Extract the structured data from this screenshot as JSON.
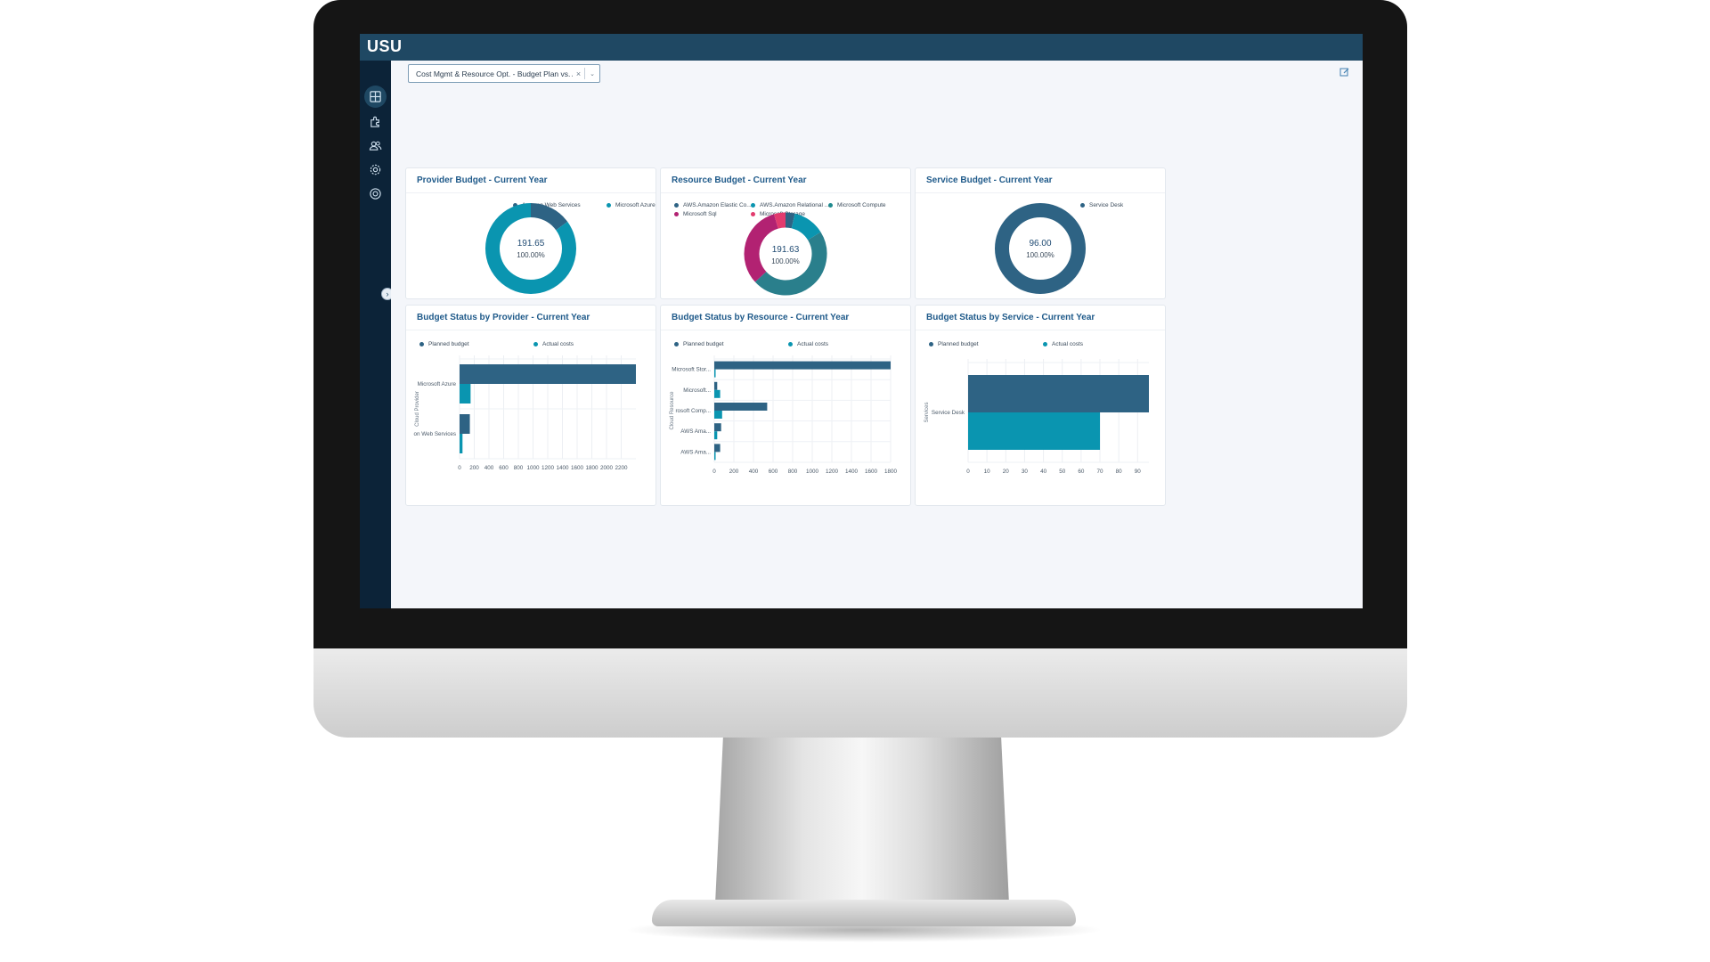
{
  "app": {
    "logo": "USU"
  },
  "toolbar": {
    "dashboard_value": "Cost Mgmt & Resource Opt. - Budget Plan vs. Act",
    "clear_label": "×",
    "chevron_label": "⌄"
  },
  "sidebar": {
    "items": [
      {
        "icon": "dashboard-icon",
        "active": true
      },
      {
        "icon": "puzzle-icon",
        "active": false
      },
      {
        "icon": "users-icon",
        "active": false
      },
      {
        "icon": "gear-icon",
        "active": false
      },
      {
        "icon": "help-icon",
        "active": false
      }
    ],
    "collapse_label": "›"
  },
  "colors": {
    "navy": "#2e6384",
    "teal": "#0a95b0",
    "magenta": "#b22272",
    "pink": "#e23b6e",
    "slate": "#3a5b72"
  },
  "cards": {
    "provider_budget": {
      "title": "Provider Budget - Current Year",
      "legend": [
        "Amazon Web Services",
        "Microsoft Azure"
      ],
      "center_value": "191.65",
      "center_pct": "100.00%"
    },
    "resource_budget": {
      "title": "Resource Budget - Current Year",
      "legend": [
        "AWS.Amazon Elastic Co...",
        "AWS.Amazon Relational ...",
        "Microsoft Compute",
        "Microsoft Sql",
        "Microsoft Storage"
      ],
      "center_value": "191.63",
      "center_pct": "100.00%"
    },
    "service_budget": {
      "title": "Service Budget - Current Year",
      "legend": [
        "Service Desk"
      ],
      "center_value": "96.00",
      "center_pct": "100.00%"
    },
    "status_provider": {
      "title": "Budget Status by Provider - Current Year",
      "legend": [
        "Planned budget",
        "Actual costs"
      ]
    },
    "status_resource": {
      "title": "Budget Status by Resource - Current Year",
      "legend": [
        "Planned budget",
        "Actual costs"
      ]
    },
    "status_service": {
      "title": "Budget Status by Service - Current Year",
      "legend": [
        "Planned budget",
        "Actual costs"
      ]
    }
  },
  "chart_data": [
    {
      "type": "pie",
      "title": "Provider Budget - Current Year",
      "labels": [
        "Amazon Web Services",
        "Microsoft Azure"
      ],
      "values": [
        28.65,
        163.0
      ],
      "total_label": "191.65"
    },
    {
      "type": "pie",
      "title": "Resource Budget - Current Year",
      "labels": [
        "AWS.Amazon Elastic Co...",
        "AWS.Amazon Relational ...",
        "Microsoft Compute",
        "Microsoft Sql",
        "Microsoft Storage"
      ],
      "values": [
        7.0,
        24.0,
        90.0,
        62.0,
        8.63
      ],
      "total_label": "191.63"
    },
    {
      "type": "pie",
      "title": "Service Budget - Current Year",
      "labels": [
        "Service Desk"
      ],
      "values": [
        96.0
      ],
      "total_label": "96.00"
    },
    {
      "type": "bar",
      "orientation": "horizontal",
      "title": "Budget Status by Provider - Current Year",
      "ylabel": "Cloud Provider",
      "categories": [
        "Microsoft Azure",
        "on Web Services"
      ],
      "series": [
        {
          "name": "Planned budget",
          "values": [
            2400,
            140
          ]
        },
        {
          "name": "Actual costs",
          "values": [
            150,
            40
          ]
        }
      ],
      "xlim": [
        0,
        2400
      ],
      "xticks": [
        0,
        200,
        400,
        600,
        800,
        1000,
        1200,
        1400,
        1600,
        1800,
        2000,
        2200
      ]
    },
    {
      "type": "bar",
      "orientation": "horizontal",
      "title": "Budget Status by Resource - Current Year",
      "ylabel": "Cloud Resource",
      "categories": [
        "Microsoft Stor...",
        "Microsoft...",
        "rosoft Comp...",
        "AWS Ama...",
        "AWS Ama..."
      ],
      "series": [
        {
          "name": "Planned budget",
          "values": [
            1800,
            30,
            540,
            70,
            60
          ]
        },
        {
          "name": "Actual costs",
          "values": [
            10,
            60,
            80,
            30,
            10
          ]
        }
      ],
      "xlim": [
        0,
        1800
      ],
      "xticks": [
        0,
        200,
        400,
        600,
        800,
        1000,
        1200,
        1400,
        1600,
        1800
      ]
    },
    {
      "type": "bar",
      "orientation": "horizontal",
      "title": "Budget Status by Service - Current Year",
      "ylabel": "Services",
      "categories": [
        "Service Desk"
      ],
      "series": [
        {
          "name": "Planned budget",
          "values": [
            96
          ]
        },
        {
          "name": "Actual costs",
          "values": [
            70
          ]
        }
      ],
      "xlim": [
        0,
        96
      ],
      "xticks": [
        0,
        10,
        20,
        30,
        40,
        50,
        60,
        70,
        80,
        90
      ]
    }
  ]
}
